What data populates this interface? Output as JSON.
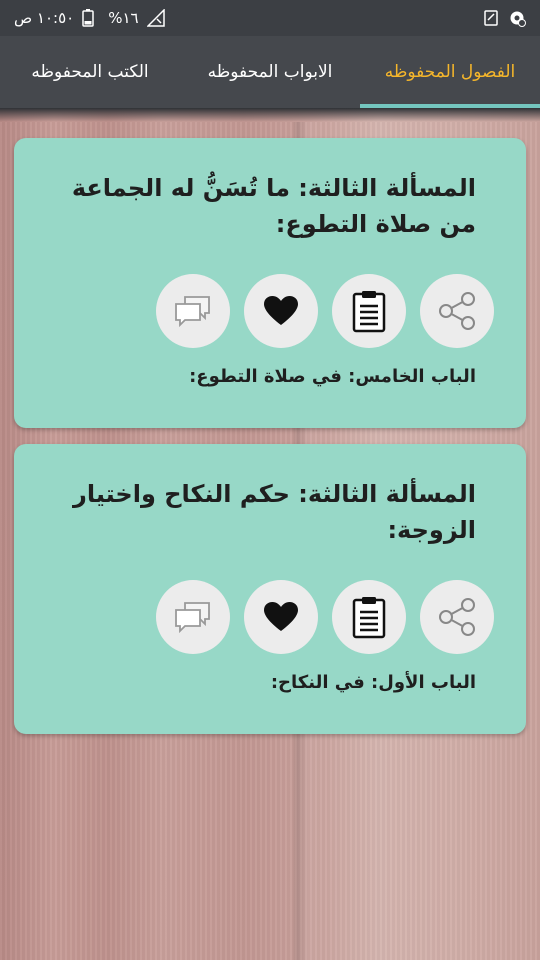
{
  "status_bar": {
    "time": "١٠:٥٠ ص",
    "battery": "%١٦"
  },
  "tabs": [
    {
      "label": "الفصول المحفوظه",
      "active": true
    },
    {
      "label": "الابواب المحفوظه",
      "active": false
    },
    {
      "label": "الكتب المحفوظه",
      "active": false
    }
  ],
  "colors": {
    "accent": "#f5b62b",
    "tab_indicator": "#74c6bf",
    "card": "#97d8c7",
    "app_bar": "#45484d"
  },
  "cards": [
    {
      "title": "المسألة الثالثة: ما تُسَنُّ له الجماعة من صلاة التطوع:",
      "subtitle": "الباب  الخامس: في صلاة التطوع:"
    },
    {
      "title": "المسألة الثالثة: حكم النكاح واختيار الزوجة:",
      "subtitle": "الباب  الأول: في النكاح:"
    }
  ],
  "icons": [
    "share-icon",
    "clipboard-icon",
    "heart-icon",
    "comments-icon"
  ]
}
